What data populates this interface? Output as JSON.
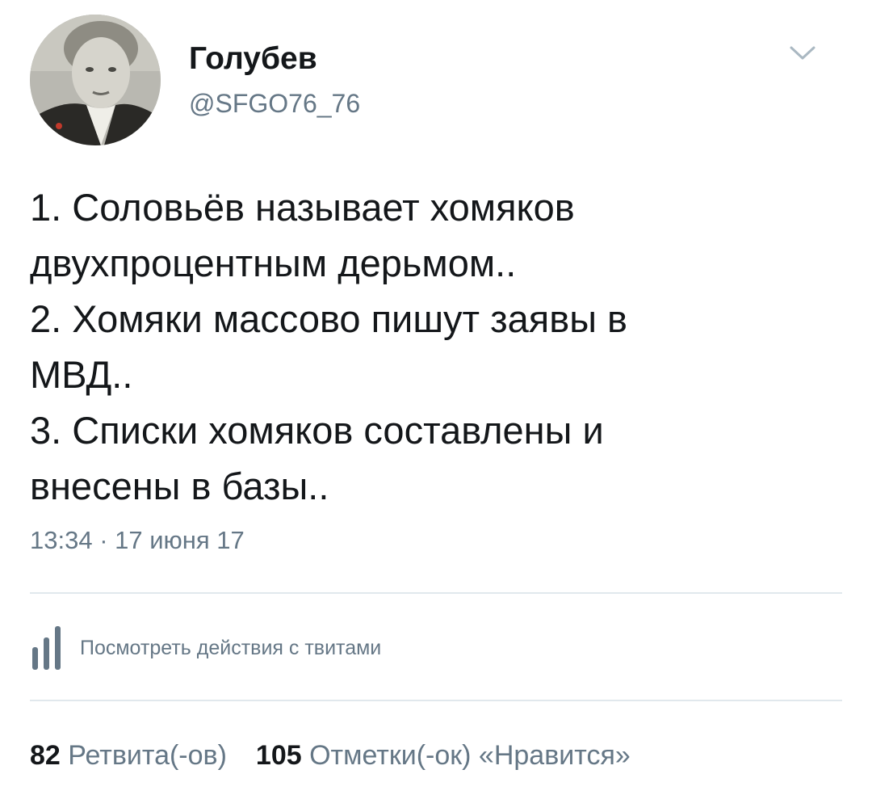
{
  "tweet": {
    "author": {
      "display_name": "Голубев",
      "handle": "@SFGO76_76"
    },
    "text_lines": [
      "1. Соловьёв называет хомяков",
      "двухпроцентным дерьмом..",
      "2. Хомяки массово пишут заявы в",
      "МВД..",
      "3. Списки хомяков составлены и",
      "внесены в базы.."
    ],
    "timestamp": "13:34 · 17 июня 17",
    "activity_label": "Посмотреть действия с твитами",
    "stats": {
      "retweets_count": "82",
      "retweets_label": "Ретвита(-ов)",
      "likes_count": "105",
      "likes_label": "Отметки(-ок) «Нравится»"
    }
  },
  "icons": {
    "more": "chevron-down-icon",
    "activity": "bar-chart-icon"
  },
  "colors": {
    "text": "#14171a",
    "secondary": "#657786",
    "divider": "#e1e8ed"
  }
}
